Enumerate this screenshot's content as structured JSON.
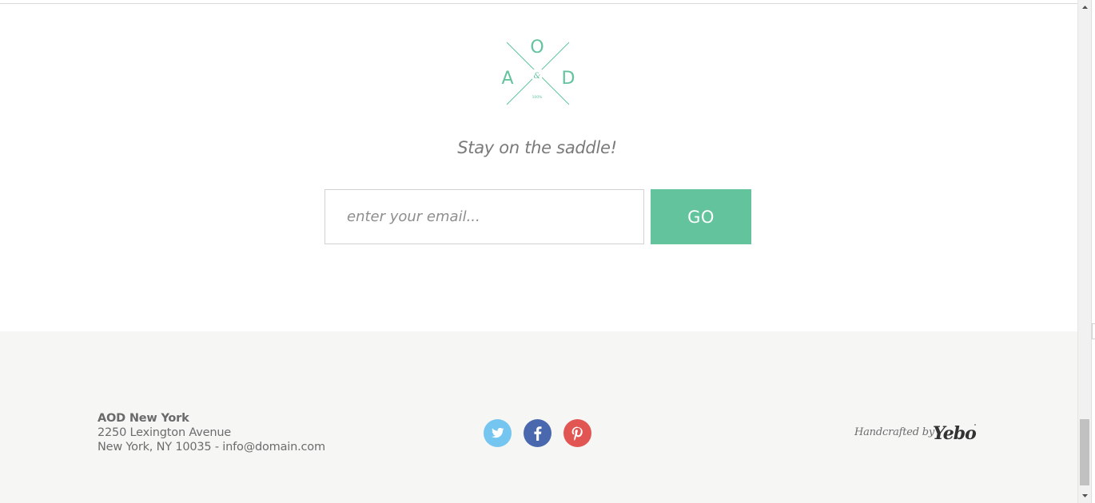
{
  "logo": {
    "letters": {
      "top": "O",
      "left": "A",
      "right": "D",
      "center": "&"
    },
    "small_text": "100%",
    "color": "#62c39c"
  },
  "newsletter": {
    "tagline": "Stay on the saddle!",
    "email_placeholder": "enter your email...",
    "submit_label": "GO",
    "accent_color": "#62c39c"
  },
  "footer": {
    "company": "AOD New York",
    "address_line1": "2250 Lexington Avenue",
    "address_line2": "New York, NY 10035 - info@domain.com",
    "social": {
      "twitter_icon": "twitter-icon",
      "facebook_icon": "facebook-icon",
      "pinterest_icon": "pinterest-icon",
      "twitter_color": "#74c5ef",
      "facebook_color": "#4a68ad",
      "pinterest_color": "#e15653"
    },
    "credit_text": "Handcrafted by",
    "credit_brand": "Yebo"
  }
}
